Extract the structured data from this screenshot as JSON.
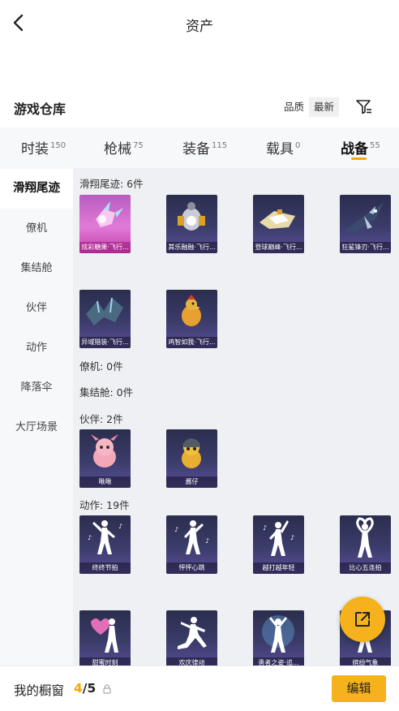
{
  "header": {
    "title": "资产"
  },
  "warehouse": {
    "title": "游戏仓库",
    "sort_options": [
      "品质",
      "最新"
    ],
    "sort_selected": "最新"
  },
  "tabs": [
    {
      "label": "时装",
      "count": "150"
    },
    {
      "label": "枪械",
      "count": "75"
    },
    {
      "label": "装备",
      "count": "115"
    },
    {
      "label": "载具",
      "count": "0"
    },
    {
      "label": "战备",
      "count": "55",
      "active": true
    }
  ],
  "sidebar": {
    "items": [
      "滑翔尾迹",
      "僚机",
      "集结舱",
      "伙伴",
      "动作",
      "降落伞",
      "大厅场景"
    ],
    "active": "滑翔尾迹"
  },
  "sections": [
    {
      "title": "滑翔尾迹: 6件",
      "items": [
        "炫彩糖果·飞行...",
        "其乐融融·飞行...",
        "登球巅峰·飞行...",
        "狂鲨锋刃·飞行...",
        "异域猎装·飞行...",
        "鸡智如我·飞行..."
      ]
    },
    {
      "title": "僚机: 0件",
      "items": []
    },
    {
      "title": "集结舱: 0件",
      "items": []
    },
    {
      "title": "伙伴: 2件",
      "items": [
        "啾啾",
        "酱仔"
      ]
    },
    {
      "title": "动作: 19件",
      "items": [
        "终终节拍",
        "怦怦心跳",
        "越打越年轻",
        "比心五连拍",
        "甜蜜时刻",
        "欢庆律动",
        "勇者之姿·追...",
        "缤纷气象"
      ]
    }
  ],
  "bottom": {
    "showcase_label": "我的橱窗",
    "showcase_current": "4",
    "showcase_sep": "/",
    "showcase_total": "5",
    "edit_label": "编辑"
  },
  "colors": {
    "accent": "#f5b21c",
    "tab_underline": "#f5a800"
  },
  "icons": [
    "back-arrow-icon",
    "filter-icon",
    "share-external-icon",
    "lock-icon"
  ]
}
